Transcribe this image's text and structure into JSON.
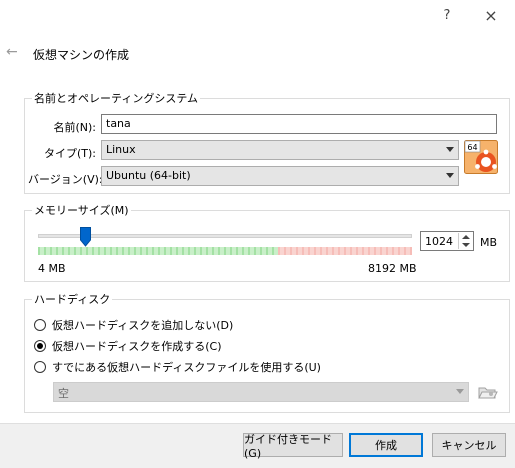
{
  "window": {
    "help_glyph": "?",
    "close_glyph": "×",
    "back_glyph": "←",
    "title": "仮想マシンの作成"
  },
  "name_os": {
    "legend": "名前とオペレーティングシステム",
    "name_label": "名前(N):",
    "name_value": "tana",
    "type_label": "タイプ(T):",
    "type_value": "Linux",
    "version_label": "バージョン(V):",
    "version_value": "Ubuntu (64-bit)",
    "os_badge": "64"
  },
  "memory": {
    "legend": "メモリーサイズ(M)",
    "value": "1024",
    "unit": "MB",
    "min_label": "4 MB",
    "max_label": "8192 MB",
    "min_mb": 4,
    "max_mb": 8192,
    "current_mb": 1024
  },
  "disk": {
    "legend": "ハードディスク",
    "options": [
      {
        "label": "仮想ハードディスクを追加しない(D)",
        "checked": false
      },
      {
        "label": "仮想ハードディスクを作成する(C)",
        "checked": true
      },
      {
        "label": "すでにある仮想ハードディスクファイルを使用する(U)",
        "checked": false
      }
    ],
    "file_value": "空"
  },
  "buttons": {
    "guided": "ガイド付きモード(G)",
    "create": "作成",
    "cancel": "キャンセル"
  },
  "colors": {
    "ticks_green": "#7ed37e",
    "ticks_red": "#f2a6a0",
    "thumb": "#0066cc",
    "default_border": "#0078d7"
  }
}
